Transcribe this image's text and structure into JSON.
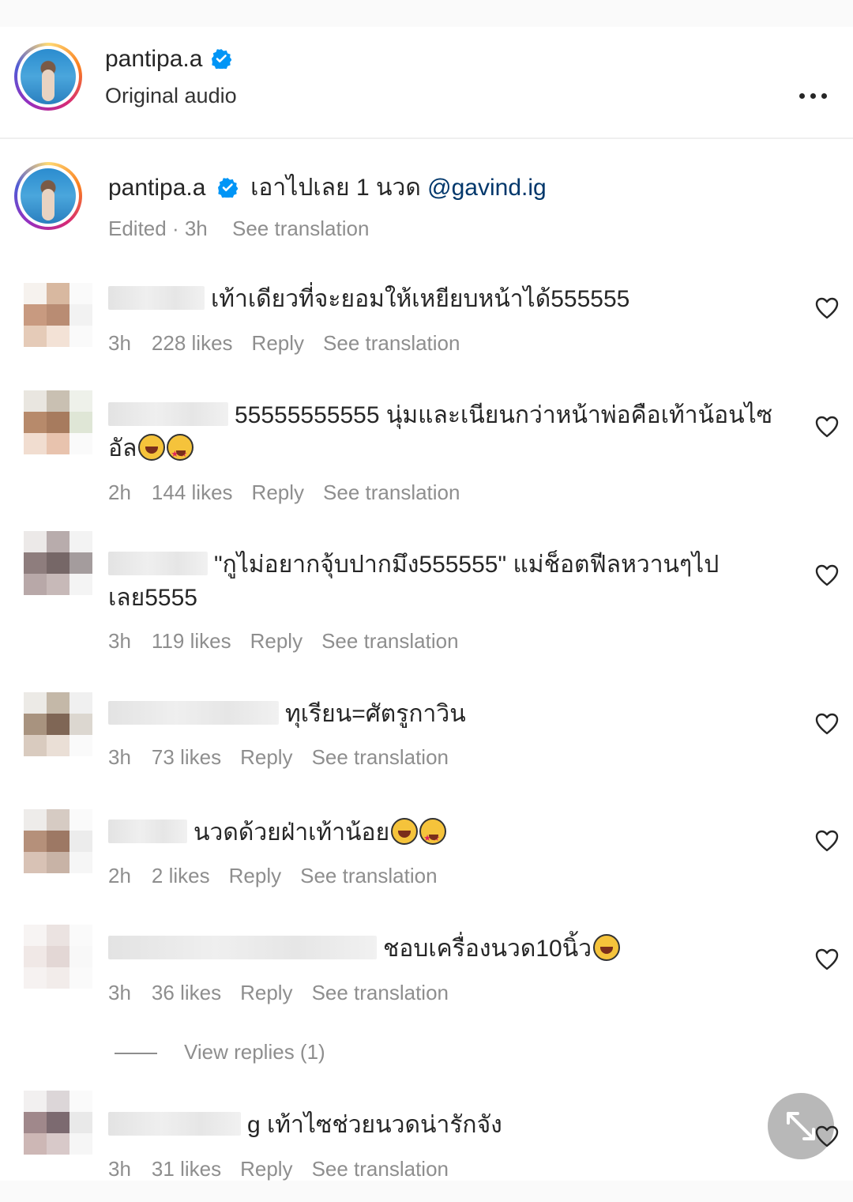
{
  "post_header": {
    "username": "pantipa.a",
    "subtitle": "Original audio"
  },
  "caption": {
    "username": "pantipa.a",
    "text": "เอาไปเลย 1 นวด",
    "mention": "@gavind.ig",
    "meta_time": "Edited · 3h",
    "see_translation": "See translation"
  },
  "comments": [
    {
      "text": "เท้าเดียวที่จะยอมให้เหยียบหน้าได้555555",
      "time": "3h",
      "likes": "228 likes",
      "reply": "Reply",
      "see_translation": "See translation"
    },
    {
      "text": "55555555555 นุ่มและเนียนกว่าหน้าพ่อคือเท้าน้อนไซ",
      "text2": "อัล",
      "time": "2h",
      "likes": "144 likes",
      "reply": "Reply",
      "see_translation": "See translation"
    },
    {
      "text": "\"กูไม่อยากจุ้บปากมึง555555\" แม่ช็อตฟีลหวานๆไป",
      "text2": "เลย5555",
      "time": "3h",
      "likes": "119 likes",
      "reply": "Reply",
      "see_translation": "See translation"
    },
    {
      "text": "ทุเรียน=ศัตรูกาวิน",
      "time": "3h",
      "likes": "73 likes",
      "reply": "Reply",
      "see_translation": "See translation"
    },
    {
      "text": "นวดด้วยฝ่าเท้าน้อย",
      "time": "2h",
      "likes": "2 likes",
      "reply": "Reply",
      "see_translation": "See translation"
    },
    {
      "text": "ชอบเครื่องนวด10นิ้ว",
      "time": "3h",
      "likes": "36 likes",
      "reply": "Reply",
      "see_translation": "See translation"
    },
    {
      "text": "g เท้าไซช่วยนวดน่ารักจัง",
      "time": "3h",
      "likes": "31 likes",
      "reply": "Reply",
      "see_translation": "See translation"
    }
  ],
  "view_replies": "View replies (1)",
  "icons": {
    "verified": "verified-badge-icon",
    "more": "more-options-icon",
    "heart": "heart-outline-icon",
    "expand": "expand-arrows-icon"
  },
  "colors": {
    "verified": "#0095f6",
    "muted": "#8e8e8e",
    "mention": "#00376b"
  }
}
